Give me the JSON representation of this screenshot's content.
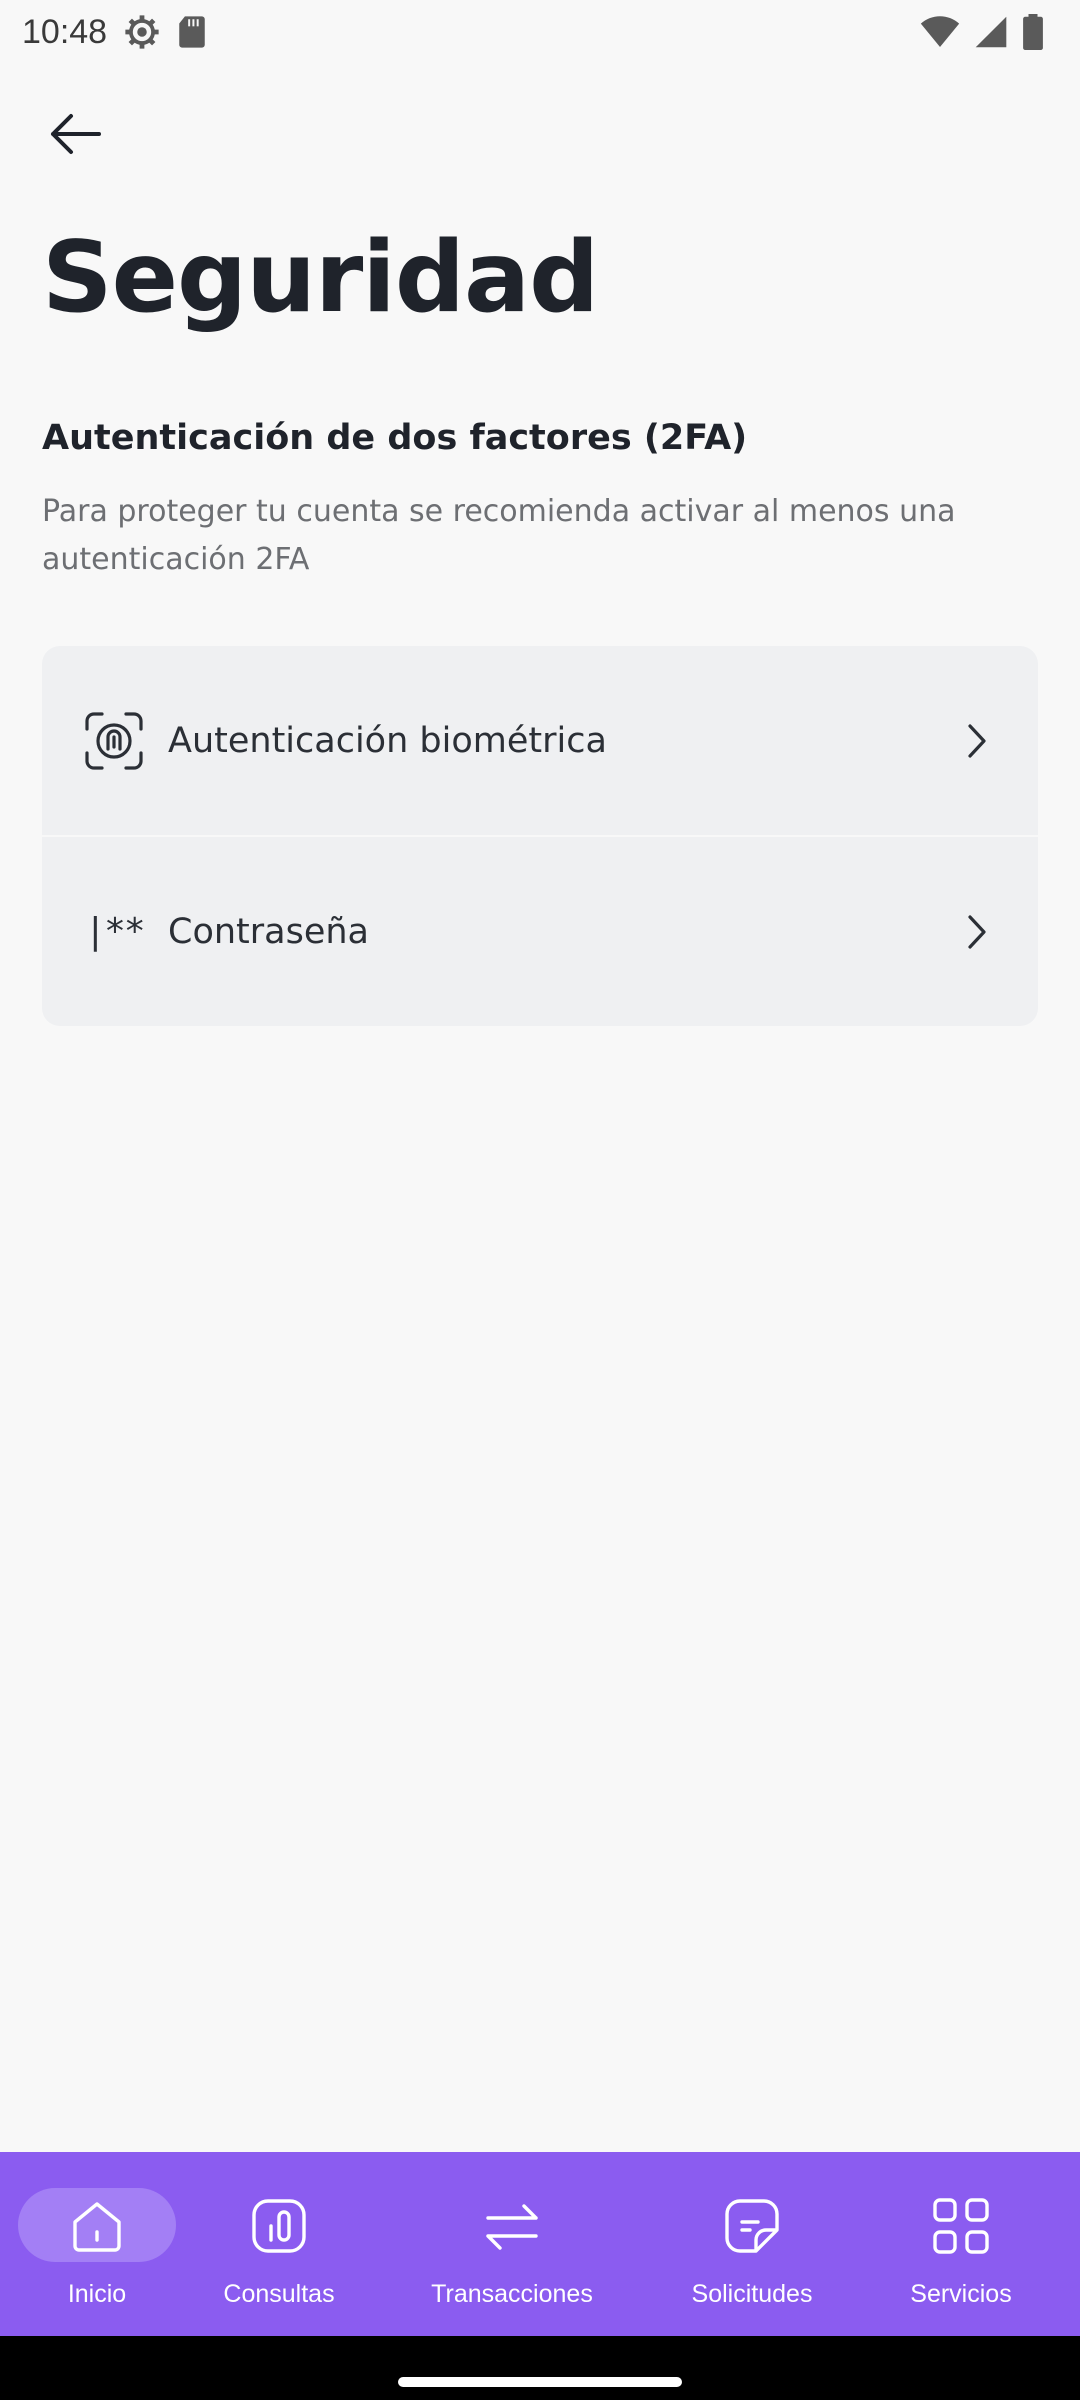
{
  "status_bar": {
    "time": "10:48",
    "icons": [
      "settings-icon",
      "sd-card-icon",
      "wifi-icon",
      "cell-signal-icon",
      "battery-icon"
    ]
  },
  "header": {
    "back_icon": "arrow-left-icon",
    "title": "Seguridad"
  },
  "section": {
    "title": "Autenticación de dos factores (2FA)",
    "description": "Para proteger tu cuenta se recomienda activar al menos una autenticación 2FA"
  },
  "options": [
    {
      "label": "Autenticación biométrica",
      "icon": "face-id-icon"
    },
    {
      "label": "Contraseña",
      "icon": "password-icon",
      "glyph": "|**"
    }
  ],
  "bottom_nav": {
    "items": [
      {
        "label": "Inicio",
        "icon": "home-icon",
        "active": true
      },
      {
        "label": "Consultas",
        "icon": "chart-icon",
        "active": false
      },
      {
        "label": "Transacciones",
        "icon": "transfer-icon",
        "active": false
      },
      {
        "label": "Solicitudes",
        "icon": "document-icon",
        "active": false
      },
      {
        "label": "Servicios",
        "icon": "grid-icon",
        "active": false
      }
    ]
  },
  "colors": {
    "background": "#f8f8f8",
    "card": "#eff0f2",
    "nav_background": "#8b5cf0",
    "nav_active_pill": "#a37ff5",
    "title_text": "#1f232b",
    "secondary_text": "#6d6f73"
  }
}
